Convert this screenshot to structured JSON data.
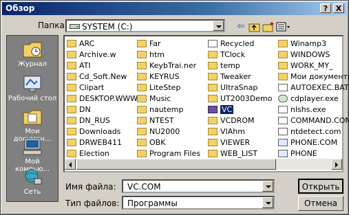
{
  "window": {
    "title": "Обзор",
    "help_label": "?",
    "close_label": "X"
  },
  "look_in": {
    "label": "Папка:",
    "value": "SYSTEM (C:)"
  },
  "places": [
    {
      "label": "Журнал",
      "icon": "history-folder-icon"
    },
    {
      "label": "Рабочий стол",
      "icon": "desktop-icon"
    },
    {
      "label": "Мои докумен...",
      "icon": "my-documents-icon"
    },
    {
      "label": "Мой компью...",
      "icon": "my-computer-icon"
    },
    {
      "label": "Сеть",
      "icon": "network-icon"
    }
  ],
  "files": {
    "col1": [
      "ARC",
      "Archive.w",
      "ATI",
      "Cd_Soft.New",
      "Clipart",
      "DESKTOP.WWW",
      "DN",
      "DN_RUS",
      "Downloads",
      "DRWEB411",
      "Election"
    ],
    "col2": [
      "Far",
      "htm",
      "KeybTrai.ner",
      "KEYRUS",
      "LiteStep",
      "Music",
      "nautemp",
      "NTEST",
      "NU2000",
      "OBK",
      "Program Files"
    ],
    "col3": [
      "Recycled",
      "TClock",
      "temp",
      "Tweaker",
      "UltraSnap",
      "UT2003Demo",
      "VC",
      "VCDROM",
      "VIAhm",
      "VIEWER",
      "WEB_LIST"
    ],
    "col4": [
      "Winamp3",
      "WINDOWS",
      "WORK_MY_",
      "Мои документы",
      "AUTOEXEC.BAT",
      "cdplayer.exe",
      "nlshs.exe",
      "COMMAND.COM",
      "ntdetect.com",
      "PHONE.COM",
      "PHONE"
    ]
  },
  "selected_item": "VC",
  "filename": {
    "label": "Имя файла:",
    "value": "VC.COM"
  },
  "filetype": {
    "label": "Тип файлов:",
    "value": "Программы"
  },
  "buttons": {
    "open": "Открыть",
    "cancel": "Отмена"
  },
  "colors": {
    "titlebar_start": "#0a246a",
    "titlebar_end": "#a6caf0",
    "face": "#d4d0c8",
    "places_bg": "#808080"
  }
}
